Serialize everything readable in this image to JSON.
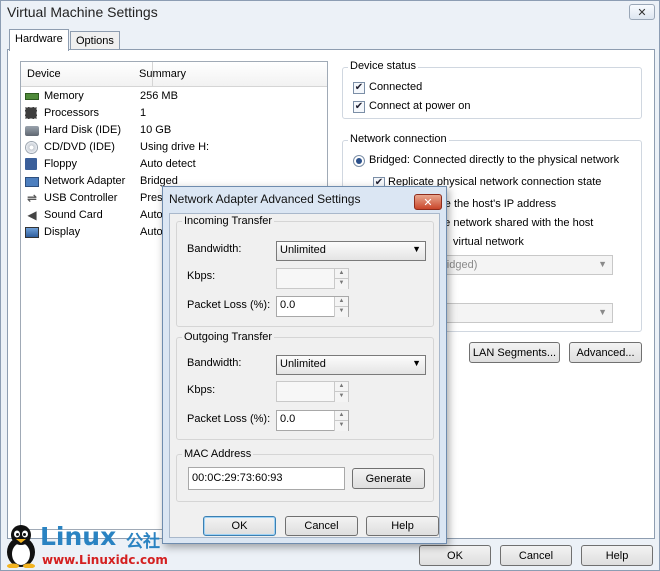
{
  "window": {
    "title": "Virtual Machine Settings",
    "close_glyph": "✕"
  },
  "tabs": [
    {
      "label": "Hardware"
    },
    {
      "label": "Options"
    }
  ],
  "device_list": {
    "col_device": "Device",
    "col_summary": "Summary",
    "rows": [
      {
        "icon": "memory-icon",
        "device": "Memory",
        "summary": "256 MB"
      },
      {
        "icon": "processor-icon",
        "device": "Processors",
        "summary": "1"
      },
      {
        "icon": "hard-disk-icon",
        "device": "Hard Disk (IDE)",
        "summary": "10 GB"
      },
      {
        "icon": "cd-dvd-icon",
        "device": "CD/DVD (IDE)",
        "summary": "Using drive H:"
      },
      {
        "icon": "floppy-icon",
        "device": "Floppy",
        "summary": "Auto detect"
      },
      {
        "icon": "network-adapter-icon",
        "device": "Network Adapter",
        "summary": "Bridged"
      },
      {
        "icon": "usb-icon",
        "device": "USB Controller",
        "summary": "Prese"
      },
      {
        "icon": "sound-card-icon",
        "device": "Sound Card",
        "summary": "Auto"
      },
      {
        "icon": "display-icon",
        "device": "Display",
        "summary": "Auto"
      }
    ]
  },
  "device_status": {
    "label": "Device status",
    "connected": {
      "label": "Connected",
      "checked": true
    },
    "connect_at_power_on": {
      "label": "Connect at power on",
      "checked": true
    }
  },
  "network_connection": {
    "label": "Network connection",
    "bridged": "Bridged: Connected directly to the physical network",
    "replicate": "Replicate physical network connection state",
    "nat_fragment": "are the host's IP address",
    "hostonly_fragment": "ate network shared with the host",
    "custom_fragment": "virtual network",
    "custom_combo_fragment": "bridged)",
    "lan_segments_button": "LAN Segments...",
    "advanced_button": "Advanced..."
  },
  "footer": {
    "ok": "OK",
    "cancel": "Cancel",
    "help": "Help"
  },
  "dialog": {
    "title": "Network Adapter Advanced Settings",
    "close_glyph": "✕",
    "incoming": {
      "label": "Incoming Transfer",
      "bandwidth_label": "Bandwidth:",
      "bandwidth_value": "Unlimited",
      "kbps_label": "Kbps:",
      "kbps_value": "",
      "packet_loss_label": "Packet Loss (%):",
      "packet_loss_value": "0.0"
    },
    "outgoing": {
      "label": "Outgoing Transfer",
      "bandwidth_label": "Bandwidth:",
      "bandwidth_value": "Unlimited",
      "kbps_label": "Kbps:",
      "kbps_value": "",
      "packet_loss_label": "Packet Loss (%):",
      "packet_loss_value": "0.0"
    },
    "mac": {
      "label": "MAC Address",
      "value": "00:0C:29:73:60:93",
      "generate_button": "Generate"
    },
    "ok": "OK",
    "cancel": "Cancel",
    "help": "Help"
  },
  "watermark": {
    "word": "Linux",
    "cn": "公社",
    "url": "www.Linuxidc.com"
  },
  "colors": {
    "accent": "#2a83c2",
    "watermark_url": "#d42020",
    "dialog_frame": "#dbe6f3"
  }
}
